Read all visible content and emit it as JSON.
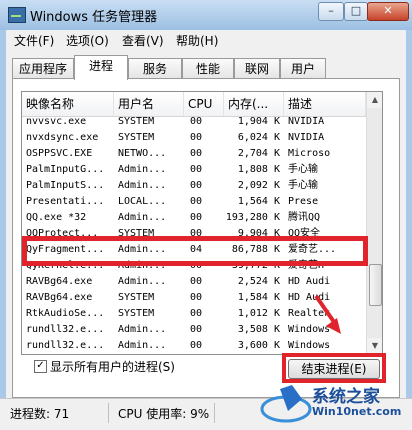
{
  "window": {
    "title": "Windows 任务管理器"
  },
  "caption_buttons": {
    "minimize": "–",
    "maximize": "□",
    "close": "✕"
  },
  "menu": [
    "文件(F)",
    "选项(O)",
    "查看(V)",
    "帮助(H)"
  ],
  "tabs": [
    "应用程序",
    "进程",
    "服务",
    "性能",
    "联网",
    "用户"
  ],
  "active_tab": "进程",
  "columns": [
    "映像名称",
    "用户名",
    "CPU",
    "内存(...",
    "描述"
  ],
  "processes": [
    {
      "name": "nvvsvc.exe",
      "user": "SYSTEM",
      "cpu": "00",
      "mem": "1,904 K",
      "desc": "NVIDIA"
    },
    {
      "name": "nvxdsync.exe",
      "user": "SYSTEM",
      "cpu": "00",
      "mem": "6,024 K",
      "desc": "NVIDIA"
    },
    {
      "name": "OSPPSVC.EXE",
      "user": "NETWO...",
      "cpu": "00",
      "mem": "2,704 K",
      "desc": "Microso"
    },
    {
      "name": "PalmInputG...",
      "user": "Admin...",
      "cpu": "00",
      "mem": "1,808 K",
      "desc": "手心输"
    },
    {
      "name": "PalmInputS...",
      "user": "Admin...",
      "cpu": "00",
      "mem": "2,092 K",
      "desc": "手心输"
    },
    {
      "name": "Presentati...",
      "user": "LOCAL...",
      "cpu": "00",
      "mem": "1,564 K",
      "desc": "Prese"
    },
    {
      "name": "QQ.exe *32",
      "user": "Admin...",
      "cpu": "00",
      "mem": "193,280 K",
      "desc": "腾讯QQ"
    },
    {
      "name": "QQProtect...",
      "user": "SYSTEM",
      "cpu": "00",
      "mem": "9,904 K",
      "desc": "QQ安全"
    },
    {
      "name": "QyFragment...",
      "user": "Admin...",
      "cpu": "04",
      "mem": "86,788 K",
      "desc": "爱奇艺..."
    },
    {
      "name": "QyKernel.e...",
      "user": "Admin...",
      "cpu": "00",
      "mem": "39,772 K",
      "desc": "爱奇艺H"
    },
    {
      "name": "RAVBg64.exe",
      "user": "Admin...",
      "cpu": "00",
      "mem": "2,524 K",
      "desc": "HD Audi"
    },
    {
      "name": "RAVBg64.exe",
      "user": "SYSTEM",
      "cpu": "00",
      "mem": "1,584 K",
      "desc": "HD Audi"
    },
    {
      "name": "RtkAudioSe...",
      "user": "SYSTEM",
      "cpu": "00",
      "mem": "1,012 K",
      "desc": "Realtek"
    },
    {
      "name": "rundll32.e...",
      "user": "Admin...",
      "cpu": "00",
      "mem": "3,508 K",
      "desc": "Windows"
    },
    {
      "name": "rundll32.e...",
      "user": "Admin...",
      "cpu": "00",
      "mem": "3,600 K",
      "desc": "Windows"
    }
  ],
  "show_all_users": {
    "label": "显示所有用户的进程(S)",
    "checked": true,
    "mark": "✓"
  },
  "end_process_button": "结束进程(E)",
  "status": {
    "processes": "进程数: 71",
    "cpu": "CPU 使用率: 9%"
  },
  "watermark": {
    "title": "系统之家",
    "subtitle": "Win10net.com"
  },
  "colors": {
    "highlight": "#e1242b",
    "titlebar": "#aac8e8"
  },
  "icons": {
    "scroll_up": "▲",
    "scroll_down": "▼"
  }
}
